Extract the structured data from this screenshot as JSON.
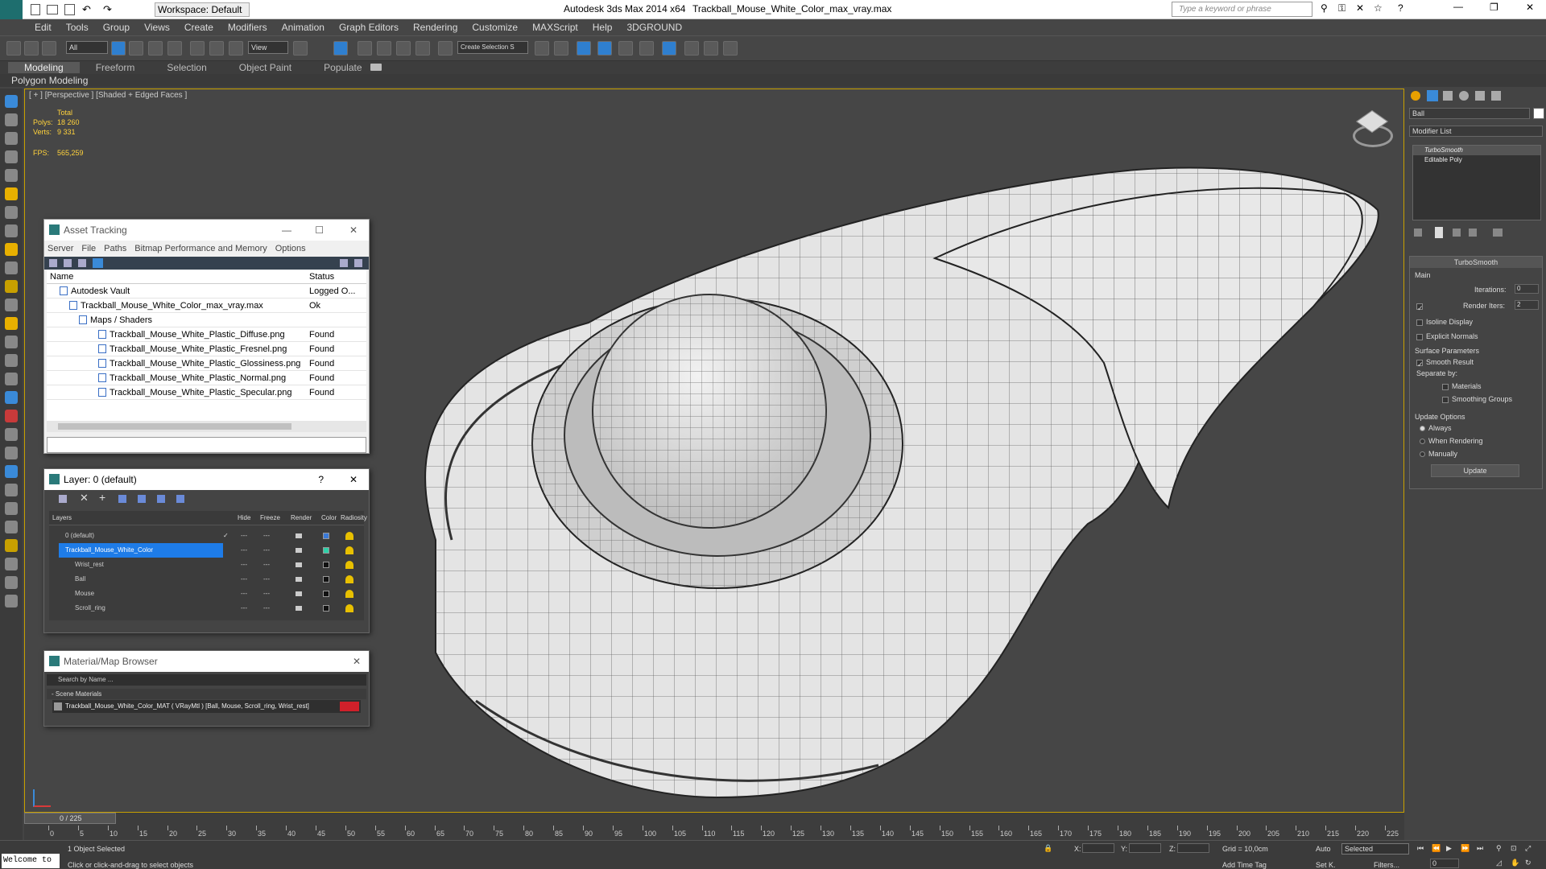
{
  "title": {
    "app": "Autodesk 3ds Max  2014 x64",
    "file": "Trackball_Mouse_White_Color_max_vray.max",
    "workspace": "Workspace: Default",
    "search_placeholder": "Type a keyword or phrase"
  },
  "menu": [
    "Edit",
    "Tools",
    "Group",
    "Views",
    "Create",
    "Modifiers",
    "Animation",
    "Graph Editors",
    "Rendering",
    "Customize",
    "MAXScript",
    "Help",
    "3DGROUND"
  ],
  "toolbar": {
    "filter": "All",
    "refcoord": "View",
    "selset": "Create Selection S"
  },
  "ribbon": {
    "tabs": [
      "Modeling",
      "Freeform",
      "Selection",
      "Object Paint",
      "Populate"
    ],
    "sub": "Polygon Modeling"
  },
  "viewport": {
    "label": "[ + ] [Perspective ] [Shaded + Edged Faces ]",
    "stats": {
      "total": "Total",
      "polys_label": "Polys:",
      "polys": "18 260",
      "verts_label": "Verts:",
      "verts": "9 331",
      "fps_label": "FPS:",
      "fps": "565,259"
    }
  },
  "asset_tracking": {
    "title": "Asset Tracking",
    "menu": [
      "Server",
      "File",
      "Paths",
      "Bitmap Performance and Memory",
      "Options"
    ],
    "col_name": "Name",
    "col_status": "Status",
    "rows": [
      {
        "name": "Autodesk Vault",
        "status": "Logged O..."
      },
      {
        "name": "Trackball_Mouse_White_Color_max_vray.max",
        "status": "Ok"
      },
      {
        "name": "Maps / Shaders",
        "status": ""
      },
      {
        "name": "Trackball_Mouse_White_Plastic_Diffuse.png",
        "status": "Found"
      },
      {
        "name": "Trackball_Mouse_White_Plastic_Fresnel.png",
        "status": "Found"
      },
      {
        "name": "Trackball_Mouse_White_Plastic_Glossiness.png",
        "status": "Found"
      },
      {
        "name": "Trackball_Mouse_White_Plastic_Normal.png",
        "status": "Found"
      },
      {
        "name": "Trackball_Mouse_White_Plastic_Specular.png",
        "status": "Found"
      }
    ]
  },
  "layer": {
    "title": "Layer: 0 (default)",
    "help": "?",
    "cols": [
      "Layers",
      "Hide",
      "Freeze",
      "Render",
      "Color",
      "Radiosity"
    ],
    "rows": [
      {
        "name": "0 (default)",
        "color": "#3a7ad8"
      },
      {
        "name": "Trackball_Mouse_White_Color",
        "color": "#2fd0a8"
      },
      {
        "name": "Wrist_rest",
        "color": "#111111"
      },
      {
        "name": "Ball",
        "color": "#111111"
      },
      {
        "name": "Mouse",
        "color": "#111111"
      },
      {
        "name": "Scroll_ring",
        "color": "#111111"
      }
    ]
  },
  "material_browser": {
    "title": "Material/Map Browser",
    "search": "Search by Name ...",
    "section": "- Scene Materials",
    "item": "Trackball_Mouse_White_Color_MAT ( VRayMtl ) [Ball, Mouse, Scroll_ring, Wrist_rest]"
  },
  "command_panel": {
    "object_name": "Ball",
    "modifier_list": "Modifier List",
    "stack": [
      "TurboSmooth",
      "Editable Poly"
    ],
    "rollout": "TurboSmooth",
    "main": "Main",
    "iterations_label": "Iterations:",
    "iterations": "0",
    "render_iters_label": "Render Iters:",
    "render_iters": "2",
    "isoline": "Isoline Display",
    "explicit": "Explicit Normals",
    "surface": "Surface Parameters",
    "smooth_result": "Smooth Result",
    "separate_by": "Separate by:",
    "materials": "Materials",
    "smoothing_groups": "Smoothing Groups",
    "update_options": "Update Options",
    "always": "Always",
    "when_rendering": "When Rendering",
    "manually": "Manually",
    "update": "Update"
  },
  "timeline": {
    "frame": "0 / 225",
    "ticks": [
      "0",
      "5",
      "10",
      "15",
      "20",
      "25",
      "30",
      "35",
      "40",
      "45",
      "50",
      "55",
      "60",
      "65",
      "70",
      "75",
      "80",
      "85",
      "90",
      "95",
      "100",
      "105",
      "110",
      "115",
      "120",
      "125",
      "130",
      "135",
      "140",
      "145",
      "150",
      "155",
      "160",
      "165",
      "170",
      "175",
      "180",
      "185",
      "190",
      "195",
      "200",
      "205",
      "210",
      "215",
      "220",
      "225"
    ]
  },
  "status": {
    "welcome": "Welcome to",
    "selected": "1 Object Selected",
    "hint": "Click or click-and-drag to select objects",
    "x": "X:",
    "y": "Y:",
    "z": "Z:",
    "grid": "Grid = 10,0cm",
    "auto": "Auto",
    "setk": "Set K.",
    "sel_mode": "Selected",
    "filters": "Filters...",
    "add_time_tag": "Add Time Tag",
    "frame": "0"
  }
}
